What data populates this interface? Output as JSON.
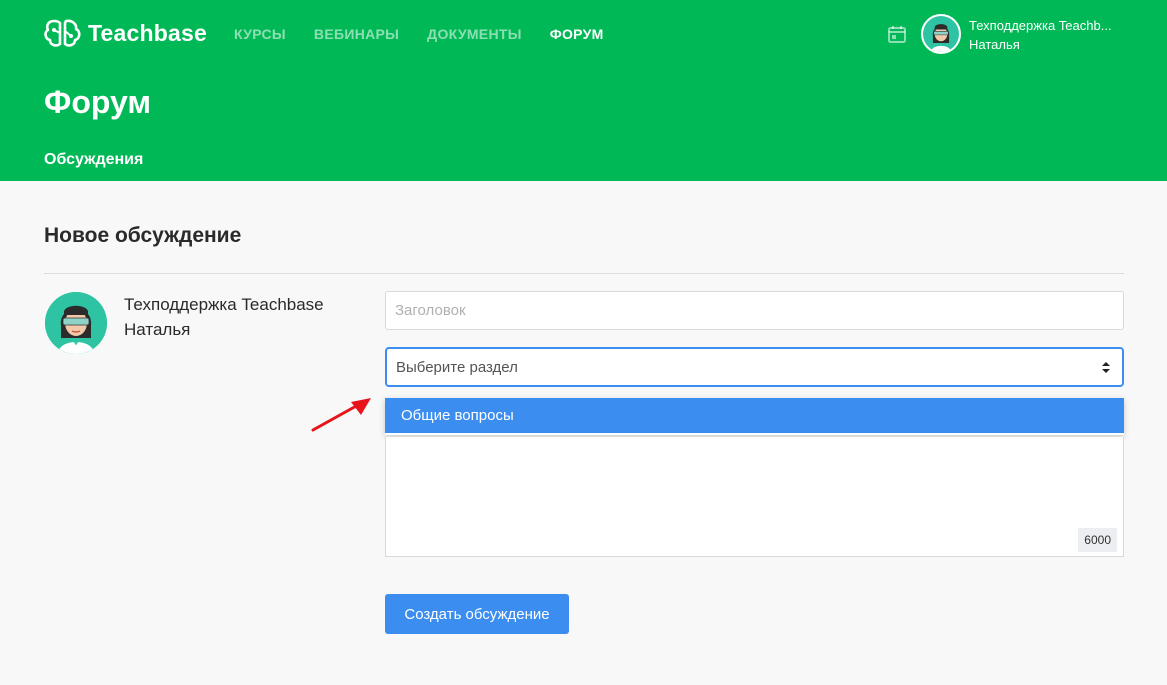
{
  "header": {
    "brand": "Teachbase",
    "nav": [
      "КУРСЫ",
      "ВЕБИНАРЫ",
      "ДОКУМЕНТЫ",
      "ФОРУМ"
    ],
    "active_nav_index": 3,
    "user": {
      "line1": "Техподдержка Teachb...",
      "line2": "Наталья"
    },
    "page_title": "Форум",
    "subtab": "Обсуждения"
  },
  "form": {
    "section_title": "Новое обсуждение",
    "author": {
      "line1": "Техподдержка Teachbase",
      "line2": "Наталья"
    },
    "title_placeholder": "Заголовок",
    "select_placeholder": "Выберите раздел",
    "dropdown_options": [
      "Общие вопросы"
    ],
    "char_counter": "6000",
    "submit_label": "Создать обсуждение"
  },
  "colors": {
    "brand_green": "#00b956",
    "accent_blue": "#3b8df0",
    "annotation_red": "#e8141b"
  }
}
